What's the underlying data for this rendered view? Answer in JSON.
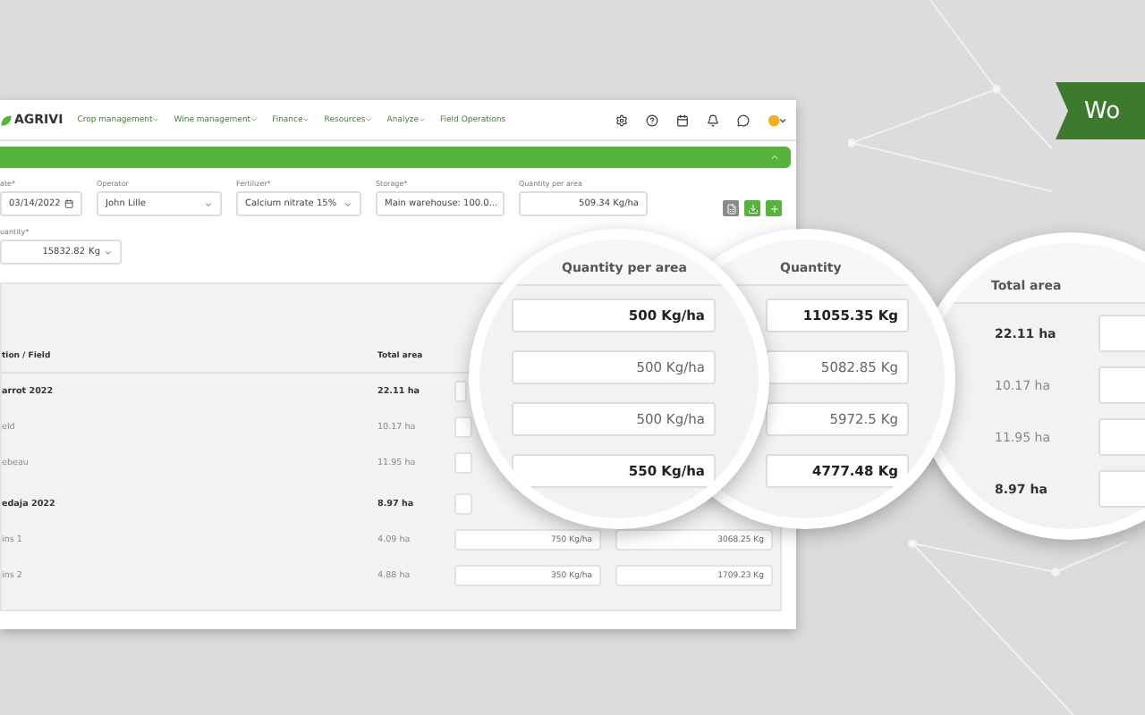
{
  "ribbon": {
    "text": "Wo"
  },
  "nav": {
    "logo": "AGRIVI",
    "menus": [
      {
        "label": "Crop management",
        "dropdown": true
      },
      {
        "label": "Wine management",
        "dropdown": true
      },
      {
        "label": "Finance",
        "dropdown": true
      },
      {
        "label": "Resources",
        "dropdown": true
      },
      {
        "label": "Analyze",
        "dropdown": true
      },
      {
        "label": "Field Operations",
        "dropdown": false
      }
    ]
  },
  "form": {
    "fields": [
      {
        "label": "ate*",
        "value": "03/14/2022",
        "kind": "date"
      },
      {
        "label": "Operator",
        "value": "John Lille",
        "kind": "select"
      },
      {
        "label": "Fertilizer*",
        "value": "Calcium nitrate 15%",
        "kind": "select"
      },
      {
        "label": "Storage*",
        "value": "Main warehouse: 100.0...",
        "kind": "select"
      },
      {
        "label": "Quantity per area",
        "value": "509.34 Kg/ha",
        "kind": "number"
      }
    ],
    "quantity": {
      "label": "uantity*",
      "value": "15832.82",
      "unit": "Kg"
    }
  },
  "table": {
    "columns": [
      "tion / Field",
      "Total area"
    ],
    "rows": [
      {
        "name": "arrot 2022",
        "total_area": "22.11 ha",
        "group": true
      },
      {
        "name": "eld",
        "total_area": "10.17 ha",
        "group": false
      },
      {
        "name": "ebeau",
        "total_area": "11.95 ha",
        "group": false
      },
      {
        "name": "edaja 2022",
        "total_area": "8.97 ha",
        "group": true
      },
      {
        "name": "ins 1",
        "total_area": "4.09 ha",
        "group": false,
        "quantity_per_area": "750 Kg/ha",
        "quantity": "3068.25 Kg"
      },
      {
        "name": "ins 2",
        "total_area": "4.88 ha",
        "group": false,
        "quantity_per_area": "350 Kg/ha",
        "quantity": "1709.23 Kg"
      }
    ]
  },
  "magnifiers": [
    {
      "kind": "input",
      "heading": "Quantity per area",
      "values": [
        {
          "text": "500 Kg/ha",
          "group": true
        },
        {
          "text": "500 Kg/ha",
          "group": false
        },
        {
          "text": "500 Kg/ha",
          "group": false
        },
        {
          "text": "550 Kg/ha",
          "group": true
        }
      ]
    },
    {
      "kind": "input",
      "heading": "Quantity",
      "values": [
        {
          "text": "11055.35 Kg",
          "group": true
        },
        {
          "text": "5082.85 Kg",
          "group": false
        },
        {
          "text": "5972.5 Kg",
          "group": false
        },
        {
          "text": "4777.48 Kg",
          "group": true
        }
      ]
    },
    {
      "kind": "text",
      "heading": "Total area",
      "values": [
        {
          "text": "22.11 ha",
          "group": true
        },
        {
          "text": "10.17 ha",
          "group": false
        },
        {
          "text": "11.95 ha",
          "group": false
        },
        {
          "text": "8.97 ha",
          "group": true
        }
      ]
    }
  ]
}
